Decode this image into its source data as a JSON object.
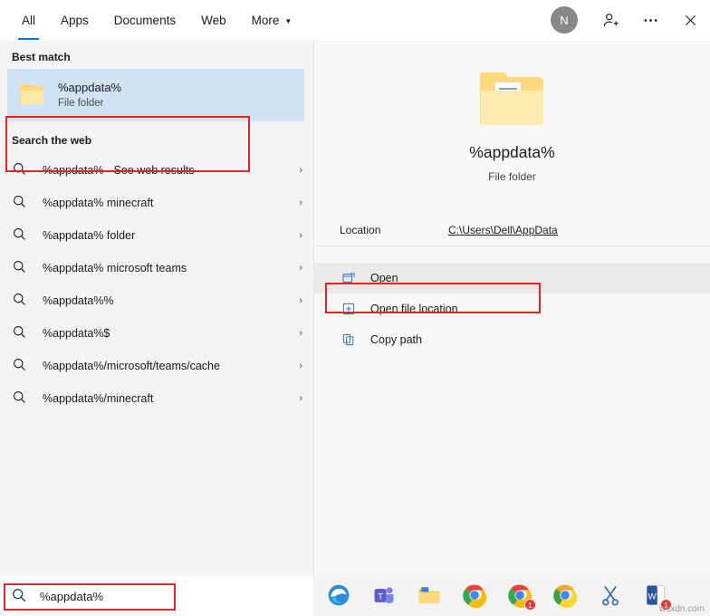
{
  "topbar": {
    "tabs": [
      {
        "label": "All",
        "active": true,
        "caret": false
      },
      {
        "label": "Apps",
        "active": false,
        "caret": false
      },
      {
        "label": "Documents",
        "active": false,
        "caret": false
      },
      {
        "label": "Web",
        "active": false,
        "caret": false
      },
      {
        "label": "More",
        "active": false,
        "caret": true
      }
    ],
    "avatar_initial": "N",
    "icons": [
      "person-add-icon",
      "ellipsis-icon",
      "close-icon"
    ],
    "accent_color": "#0078d4"
  },
  "left_panel": {
    "best_match_heading": "Best match",
    "best_match": {
      "title": "%appdata%",
      "subtitle": "File folder",
      "icon": "folder-icon",
      "highlight_color": "#cfe3f5",
      "outline_color": "#e1232a"
    },
    "web_heading": "Search the web",
    "web_results": [
      {
        "label": "%appdata% - See web results",
        "icon": "search-icon",
        "chevron": "›"
      },
      {
        "label": "%appdata% minecraft",
        "icon": "search-icon",
        "chevron": "›"
      },
      {
        "label": "%appdata% folder",
        "icon": "search-icon",
        "chevron": "›"
      },
      {
        "label": "%appdata% microsoft teams",
        "icon": "search-icon",
        "chevron": "›"
      },
      {
        "label": "%appdata%%",
        "icon": "search-icon",
        "chevron": "›"
      },
      {
        "label": "%appdata%$",
        "icon": "search-icon",
        "chevron": "›"
      },
      {
        "label": "%appdata%/microsoft/teams/cache",
        "icon": "search-icon",
        "chevron": "›"
      },
      {
        "label": "%appdata%/minecraft",
        "icon": "search-icon",
        "chevron": "›"
      }
    ]
  },
  "preview": {
    "icon": "folder-icon",
    "title": "%appdata%",
    "subtitle": "File folder",
    "location_label": "Location",
    "location_value": "C:\\Users\\Dell\\AppData",
    "actions": [
      {
        "label": "Open",
        "icon": "open-window-icon",
        "highlighted": true
      },
      {
        "label": "Open file location",
        "icon": "folder-open-icon",
        "highlighted": false
      },
      {
        "label": "Copy path",
        "icon": "copy-icon",
        "highlighted": false
      }
    ],
    "outline_color": "#e1232a"
  },
  "taskbar": {
    "search_value": "%appdata%",
    "search_icon": "search-icon",
    "outline_color": "#e1232a",
    "tray_icons": [
      {
        "name": "edge-icon",
        "badge": ""
      },
      {
        "name": "teams-icon",
        "badge": ""
      },
      {
        "name": "file-explorer-icon",
        "badge": ""
      },
      {
        "name": "chrome-icon",
        "badge": ""
      },
      {
        "name": "chrome-notification-icon",
        "badge": "1"
      },
      {
        "name": "chrome-canary-icon",
        "badge": ""
      },
      {
        "name": "snipping-tool-icon",
        "badge": ""
      },
      {
        "name": "word-icon",
        "badge": "1"
      }
    ],
    "watermark": "wsxdn.com"
  }
}
